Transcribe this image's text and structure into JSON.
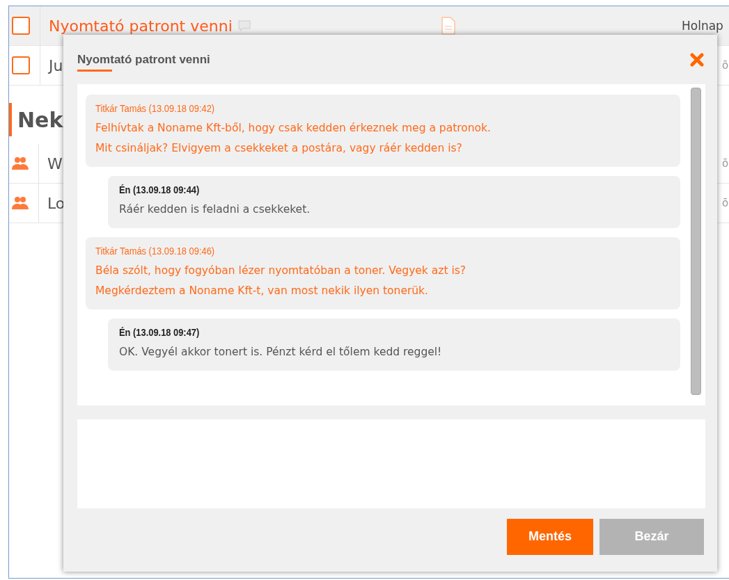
{
  "tasks": [
    {
      "checked": false,
      "title": "Nyomtató patront venni",
      "highlighted": true,
      "due": "Holnap"
    },
    {
      "checked": false,
      "title": "Ju",
      "highlighted": false,
      "due": "ō"
    }
  ],
  "section": {
    "title": "Nek"
  },
  "meetings": [
    {
      "kind": "meeting",
      "title": "W",
      "due": "ō"
    },
    {
      "kind": "meeting",
      "title": "Lo",
      "due": "ō"
    }
  ],
  "dialog": {
    "title": "Nyomtató patront venni",
    "messages": [
      {
        "kind": "incoming",
        "author": "Titkár Tamás (13.09.18 09:42)",
        "lines": [
          "Felhívtak a Noname Kft-ből, hogy csak kedden érkeznek meg a patronok.",
          "Mit csináljak? Elvigyem a csekkeket a postára, vagy ráér kedden is?"
        ]
      },
      {
        "kind": "outgoing",
        "author": "Én (13.09.18 09:44)",
        "lines": [
          "Ráér kedden is feladni a csekkeket."
        ]
      },
      {
        "kind": "incoming",
        "author": "Titkár Tamás (13.09.18 09:46)",
        "lines": [
          "Béla szólt, hogy fogyóban lézer nyomtatóban a toner. Vegyek azt is?",
          "Megkérdeztem a Noname Kft-t, van most nekik ilyen tonerük."
        ]
      },
      {
        "kind": "outgoing",
        "author": "Én (13.09.18 09:47)",
        "lines": [
          "OK. Vegyél akkor tonert is. Pénzt kérd el tőlem kedd reggel!"
        ]
      }
    ],
    "buttons": [
      {
        "kind": "primary",
        "label": "Mentés"
      },
      {
        "kind": "secondary",
        "label": "Bezár"
      }
    ]
  }
}
